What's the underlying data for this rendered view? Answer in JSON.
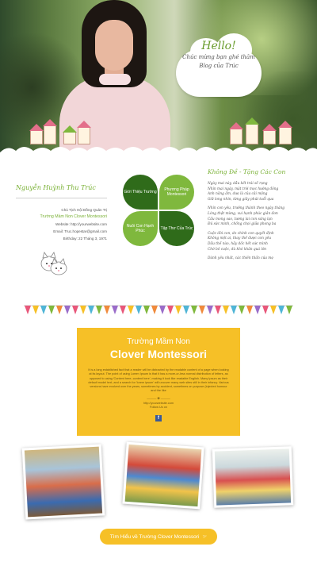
{
  "hero": {
    "hello_title": "Hello!",
    "hello_sub_line1": "Chúc mừng bạn ghé thăm",
    "hello_sub_line2": "Blog của Trúc"
  },
  "profile": {
    "signature": "Nguyễn Huỳnh Thu Trúc",
    "role": "Chủ Tịch Hội Đồng Quản Trị",
    "school": "Trường Mầm Non Clover Montessori",
    "website": "Website: http://yourwebsite.com",
    "email": "Email: Truc.hopestar@gmail.com",
    "birthday": "Birthday: 22 Tháng 3, 1971"
  },
  "clover": {
    "tl": "Giới Thiệu Trường",
    "tr": "Phương Pháp Montessori",
    "bl": "Nuôi Con Hạnh Phúc",
    "br": "Tập Thơ Của Trúc"
  },
  "poem": {
    "title": "Không Đề - Tặng Các Con",
    "stanza1": [
      "Ngày mai này, dẫu kết trái sẽ rụng",
      "Nhìn mai ngày, mặt trời mọc hướng đông",
      "Anh năng ấm, dưa là của cải mộng",
      "Giữ long nhìn, từng giây phút tuổi qua"
    ],
    "stanza2": [
      "Nhìn con yêu, trưởng thành theo ngày tháng",
      "Lòng thật mừng, vui hạnh phúc giản đơn",
      "Cầu mong sao, tương lai con sáng lạn",
      "Đủ sức mình, chống chọi giữa phong ba"
    ],
    "stanza3": [
      "Cuộc đời con, do chính con quyết định",
      "Không một ai, thay thế được con yêu",
      "Dẫu thế nào, hãy dốc hết sức mình",
      "Chớ bỏ cuộc, dù khó khăn quá lớn"
    ],
    "closing": "Dành yêu nhất, các thiên thần của mẹ"
  },
  "promo": {
    "title1": "Trường Mầm Non",
    "title2": "Clover Montessori",
    "body": "It is a long established fact that a reader will be distracted by the readable content of a page when looking at its layout. The point of using Lorem Ipsum is that it has a more-or-less normal distribution of letters, as opposed to using 'Content here, content here', making it look like readable English. Many Ipsum as their default model text, and a search for 'lorem ipsum' will uncover many web sites still in their infancy. Various versions have evolved over the years, sometimes by accident, sometimes on purpose (injected humour and the like",
    "separator": "——— ✿ ———",
    "link": "http://yourwebsite.com",
    "follow": "Follow Us on",
    "fb_icon": "f"
  },
  "cta": {
    "label": "Tìm Hiểu về Trường Clover Montessori",
    "icon": "☞"
  },
  "colors": {
    "green_dark": "#2f6b1a",
    "green_light": "#7fb83d",
    "yellow": "#f6c027"
  }
}
